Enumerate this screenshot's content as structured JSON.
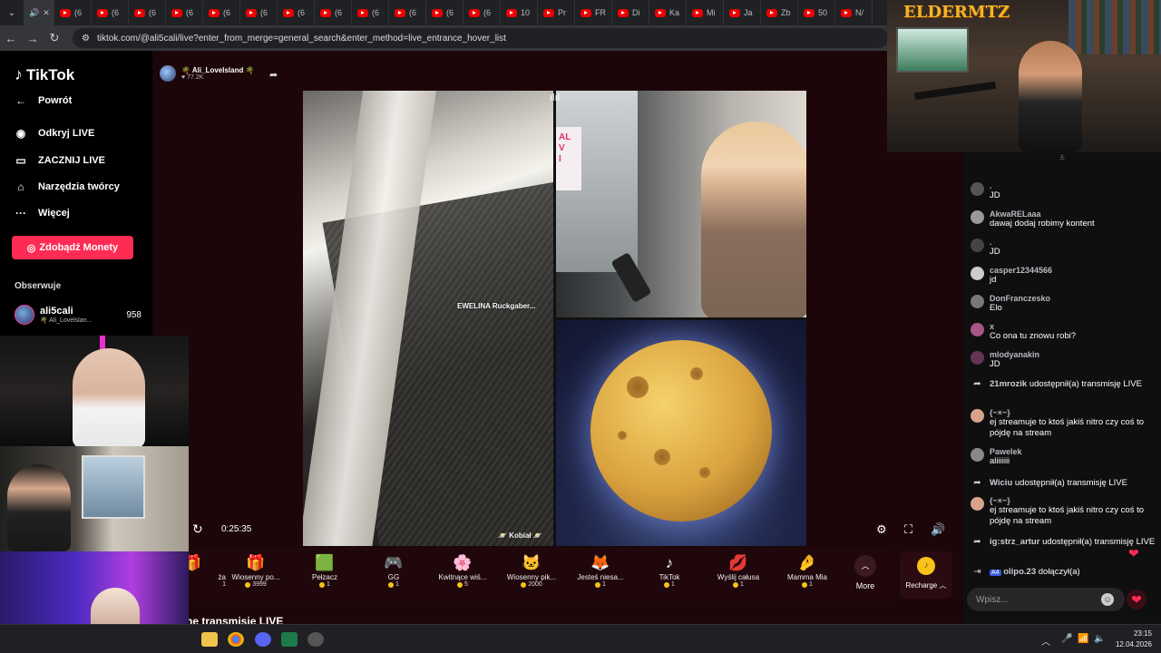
{
  "browser": {
    "tabs": [
      "(6",
      "(6",
      "(6",
      "(6",
      "(6",
      "(6",
      "(6",
      "(6",
      "(6",
      "(6",
      "(6",
      "(6",
      "10",
      "Pr",
      "FR",
      "Di",
      "Ka",
      "Mi",
      "Ja",
      "Zb",
      "50",
      "N/"
    ],
    "url": "tiktok.com/@ali5cali/live?enter_from_merge=general_search&enter_method=live_entrance_hover_list"
  },
  "sidebar": {
    "logo": "TikTok",
    "back": "Powrót",
    "items": [
      "Odkryj LIVE",
      "ZACZNIJ LIVE",
      "Narzędzia twórcy",
      "Więcej"
    ],
    "coins_button": "Zdobądź Monety",
    "following_header": "Obserwuje",
    "following": [
      {
        "name": "ali5cali",
        "sub": "🌴 Ali_Lovelslan...",
        "count": "958"
      }
    ]
  },
  "stream": {
    "host_name": "🌴 Ali_Lovelsland 🌴",
    "host_likes": "♥ 77.2K",
    "guest_name": "EWELINA Ruckgaber...",
    "guest2_badge": "🪐 Kobiał 🪐",
    "time": "0:25:35",
    "more_streams": "ne transmisje LIVE"
  },
  "gifts": [
    {
      "name": "Wiosenny po...",
      "price": "3999",
      "icon": "🎁"
    },
    {
      "name": "Pełzacz",
      "price": "1",
      "icon": "🟩"
    },
    {
      "name": "GG",
      "price": "1",
      "icon": "🎮"
    },
    {
      "name": "Kwitnące wiś...",
      "price": "5",
      "icon": "🌸"
    },
    {
      "name": "Wiosenny pik...",
      "price": "2000",
      "icon": "🐱"
    },
    {
      "name": "Jesteś niesa...",
      "price": "1",
      "icon": "🦊"
    },
    {
      "name": "TikTok",
      "price": "1",
      "icon": "♪"
    },
    {
      "name": "Wyślij całusa",
      "price": "1",
      "icon": "💋"
    },
    {
      "name": "Mamma Mia",
      "price": "1",
      "icon": "🤌"
    }
  ],
  "gift_partial": {
    "name": "ża",
    "price": "1"
  },
  "more_label": "More",
  "recharge_label": "Recharge",
  "chat": {
    "messages": [
      {
        "type": "msg",
        "user": ".",
        "text": "JD"
      },
      {
        "type": "msg",
        "user": "AkwaRELaaa",
        "text": "dawaj dodaj robimy kontent"
      },
      {
        "type": "msg",
        "user": ".",
        "text": "JD"
      },
      {
        "type": "msg",
        "user": "casper12344566",
        "text": "jd"
      },
      {
        "type": "msg",
        "user": "DonFranczesko",
        "text": "Elo"
      },
      {
        "type": "msg",
        "user": "x",
        "text": "Co ona tu znowu robi?"
      },
      {
        "type": "msg",
        "user": "mlodyanakin",
        "text": "JD"
      },
      {
        "type": "share",
        "user": "21mrozik",
        "text": "udostępnił(a) transmisję LIVE"
      },
      {
        "type": "msg",
        "user": "{~×~}",
        "text": "ej streamuje to ktoś jakiś nitro czy coś to pójdę na stream"
      },
      {
        "type": "msg",
        "user": "Pawelek",
        "text": "aliiiiiii"
      },
      {
        "type": "share",
        "user": "Wiciu",
        "text": "udostępnił(a) transmisję LIVE"
      },
      {
        "type": "msg",
        "user": "{~×~}",
        "text": "ej streamuje to ktoś jakiś nitro czy coś to pójdę na stream"
      },
      {
        "type": "share",
        "user": "ig:strz_artur",
        "text": "udostępnił(a) transmisję LIVE"
      },
      {
        "type": "join",
        "user": "olipo.23",
        "level": "A4",
        "text": "dołączył(a)"
      }
    ],
    "input_placeholder": "Wpisz..."
  },
  "overlay": {
    "logo": "ELDERMTZ"
  },
  "taskbar": {
    "time": "23:15",
    "date": "12.04.2026"
  },
  "colors": {
    "accent": "#fe2c55",
    "coin": "#f7c31a",
    "background": "#1c0609"
  }
}
